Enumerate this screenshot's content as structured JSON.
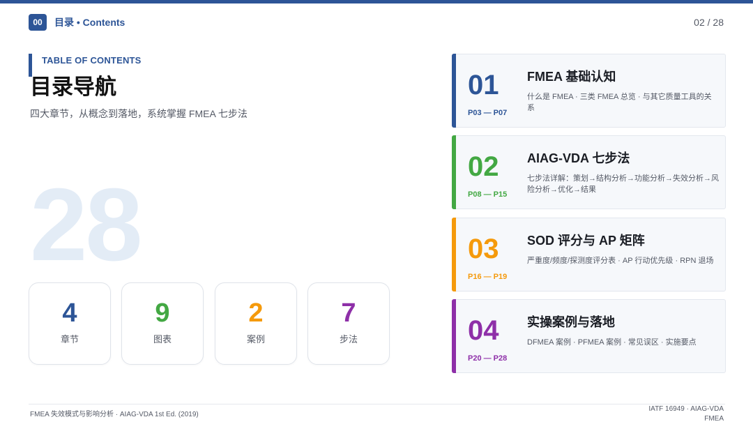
{
  "header": {
    "badge": "00",
    "title": "目录 • Contents",
    "page": "02 / 28"
  },
  "toc": {
    "label": "TABLE OF CONTENTS",
    "title": "目录导航",
    "subtitle": "四大章节，从概念到落地，系统掌握 FMEA 七步法"
  },
  "watermark": "28",
  "stats": [
    {
      "value": "4",
      "label": "章节",
      "color": "#2d5597"
    },
    {
      "value": "9",
      "label": "图表",
      "color": "#43a843"
    },
    {
      "value": "2",
      "label": "案例",
      "color": "#f59a0c"
    },
    {
      "value": "7",
      "label": "步法",
      "color": "#8e2fa8"
    }
  ],
  "chapters": [
    {
      "num": "01",
      "pages": "P03 — P07",
      "title": "FMEA 基础认知",
      "desc": "什么是 FMEA · 三类 FMEA 总览 · 与其它质量工具的关系",
      "color": "#2d5597"
    },
    {
      "num": "02",
      "pages": "P08 — P15",
      "title": "AIAG-VDA 七步法",
      "desc": "七步法详解：策划→结构分析→功能分析→失效分析→风险分析→优化→结果",
      "color": "#43a843"
    },
    {
      "num": "03",
      "pages": "P16 — P19",
      "title": "SOD 评分与 AP 矩阵",
      "desc": "严重度/频度/探测度评分表 · AP 行动优先级 · RPN 退场",
      "color": "#f59a0c"
    },
    {
      "num": "04",
      "pages": "P20 — P28",
      "title": "实操案例与落地",
      "desc": "DFMEA 案例 · PFMEA 案例 · 常见误区 · 实施要点",
      "color": "#8e2fa8"
    }
  ],
  "footer": {
    "left": "FMEA 失效模式与影响分析 · AIAG-VDA 1st Ed. (2019)",
    "right": "IATF 16949 · AIAG-VDA FMEA"
  }
}
